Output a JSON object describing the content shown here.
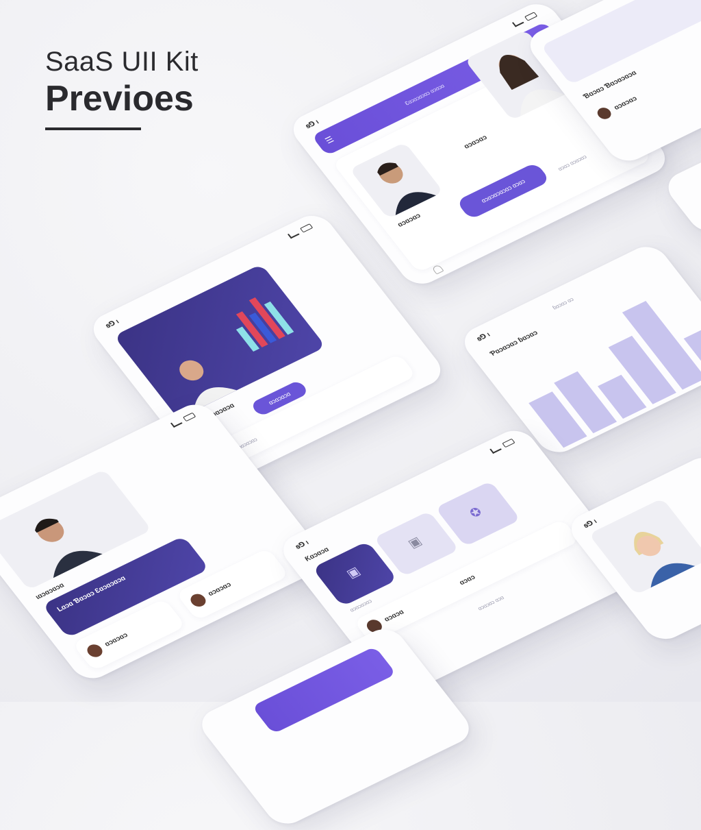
{
  "title": {
    "line1": "SaaS UII Kit",
    "line2": "Previoes"
  },
  "status": {
    "time": "ꞩ⅁ ı"
  },
  "screens": {
    "top_right": {
      "header_text": "Ɛɑɔɑɔɑɔɑɔ ɑɔɑɔɑ",
      "button_text": "ɑɔɑɔɑɔɑɔɑɔ ɑɔɑɔ",
      "name_a": "ɑɔɑɔɑɔ",
      "name_b": "ɑɔɑɔɑɔ",
      "footer": "ɑɔɑɔ ɑɔɑɔɑɔ"
    },
    "mid_left": {
      "heading": "Ɓɑɔɑɔɑ ɓɑɔɑɔɑ",
      "pill": "ɑɔɑɔɑɔɑ",
      "footer": "ɑɔɑɔɑɔɑɔ"
    },
    "chart": {
      "heading": "Ƥɑɔɑɔɑɔ ɓɑɔɑɔ",
      "caption": "ɓɑɔɑɔ ɑɔ"
    },
    "bottom_left": {
      "heading": "ɩɑɔɑɔɑɔɑ",
      "banner_title": "Lɑɔɑ Ɓɑɔɑɔ Ɛɑɔɑɔɑɔɑ",
      "name_a": "ɑɔɑɔɑɔ",
      "name_b": "ɑɔɑɔɑɔ",
      "footer": "ɑɔɑɔ ɑɔɑɔɑ"
    },
    "bottom_center": {
      "heading": "Ƙɑɔɑɔɑ",
      "tile_label": "ɑɔɑɔɑɔɑɔ",
      "name_a": "ɑɔɑɔɑ",
      "name_b": "ɑɔɑɔ",
      "footer": "ɑɔɑɔɑɔ ɑɔɑ"
    },
    "top_far_right": {
      "heading": "Ɓɑɔɑɔ Ɓɑɔɑɔɑɔɑ",
      "name_a": "ɑɔɑɔɑɔ"
    }
  },
  "chart_data": {
    "type": "bar",
    "categories": [
      "",
      "",
      "",
      "",
      "",
      ""
    ],
    "values": [
      55,
      62,
      40,
      70,
      95,
      45
    ]
  },
  "colors": {
    "accent": "#6a55d8",
    "navy": "#3b3385",
    "lavender": "#c8c4ee"
  }
}
